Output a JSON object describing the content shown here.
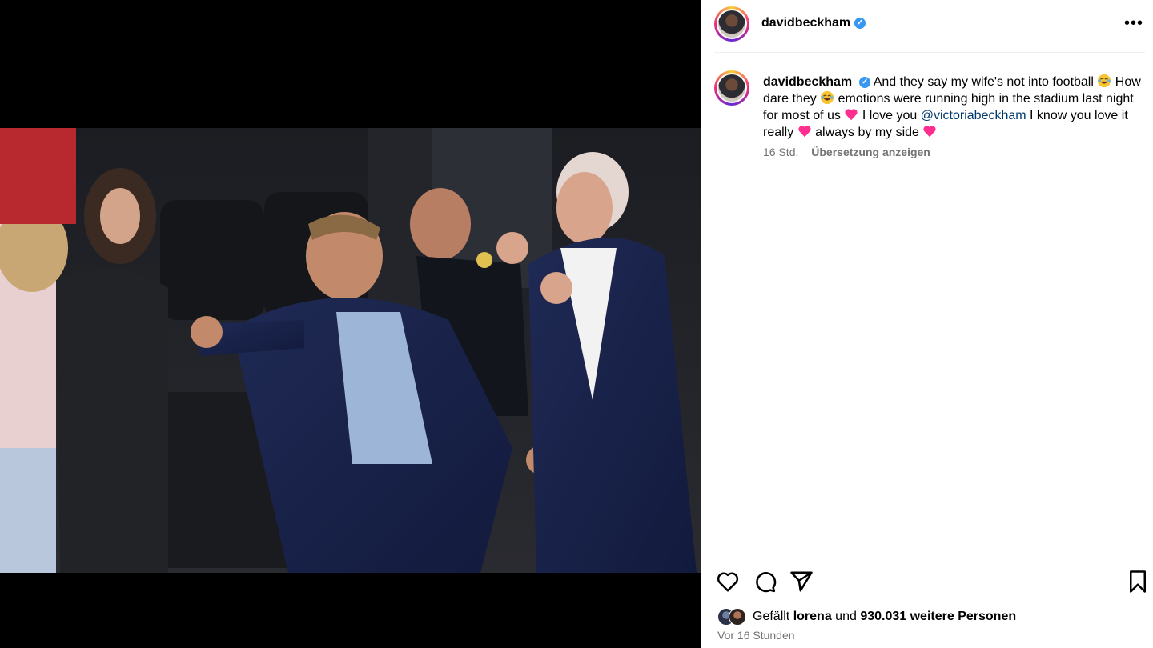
{
  "post": {
    "author": "davidbeckham",
    "caption": {
      "part1": "And they say my wife's not into football ",
      "part2": " How dare they ",
      "part3": " emotions were running high in the stadium last night for most of us ",
      "part4": " I love you ",
      "mention": "@victoriabeckham",
      "part5": " I know you love it really ",
      "part6": " always by my side "
    },
    "age": "16 Std.",
    "translate_label": "Übersetzung anzeigen",
    "likes": {
      "prefix": "Gefällt ",
      "user": "lorena",
      "middle": " und ",
      "count": "930.031 weitere Personen"
    },
    "posted_ago": "Vor 16 Stunden",
    "more_label": "•••"
  },
  "icons": {
    "verified": "verified-badge-icon",
    "laugh": "laughing-crying-emoji-icon",
    "heart_emoji": "pink-heart-emoji-icon",
    "like": "heart-icon",
    "comment": "comment-icon",
    "share": "send-icon",
    "save": "bookmark-icon",
    "more": "more-options-icon"
  },
  "colors": {
    "verified": "#3897f0",
    "mention": "#00376b",
    "secondary_text": "#737373",
    "pink_heart": "#ff2d8f"
  }
}
